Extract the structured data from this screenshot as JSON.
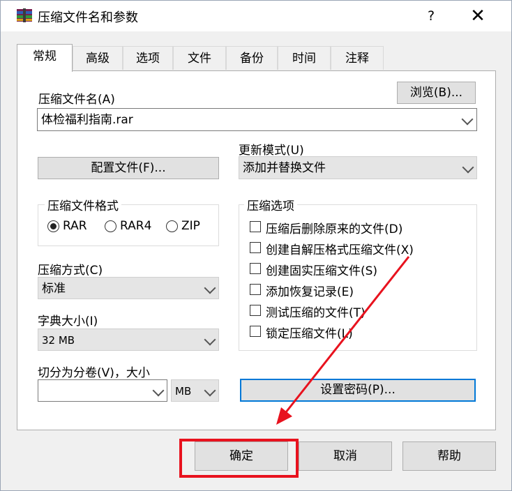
{
  "window": {
    "title": "压缩文件名和参数",
    "help": "?",
    "close": "✕"
  },
  "tabs": [
    {
      "label": "常规"
    },
    {
      "label": "高级"
    },
    {
      "label": "选项"
    },
    {
      "label": "文件"
    },
    {
      "label": "备份"
    },
    {
      "label": "时间"
    },
    {
      "label": "注释"
    }
  ],
  "general": {
    "archive_name_label": "压缩文件名(A)",
    "archive_name_value": "体检福利指南.rar",
    "browse_button": "浏览(B)...",
    "update_mode_label": "更新模式(U)",
    "update_mode_value": "添加并替换文件",
    "profiles_button": "配置文件(F)...",
    "format_group_title": "压缩文件格式",
    "formats": [
      {
        "label": "RAR",
        "selected": true
      },
      {
        "label": "RAR4",
        "selected": false
      },
      {
        "label": "ZIP",
        "selected": false
      }
    ],
    "method_label": "压缩方式(C)",
    "method_value": "标准",
    "dict_label": "字典大小(I)",
    "dict_value": "32 MB",
    "split_label": "切分为分卷(V)，大小",
    "split_value": "",
    "split_unit": "MB",
    "options_group_title": "压缩选项",
    "options": [
      {
        "label": "压缩后删除原来的文件(D)",
        "checked": false
      },
      {
        "label": "创建自解压格式压缩文件(X)",
        "checked": false
      },
      {
        "label": "创建固实压缩文件(S)",
        "checked": false
      },
      {
        "label": "添加恢复记录(E)",
        "checked": false
      },
      {
        "label": "测试压缩的文件(T)",
        "checked": false
      },
      {
        "label": "锁定压缩文件(L)",
        "checked": false
      }
    ],
    "password_button": "设置密码(P)..."
  },
  "footer": {
    "ok": "确定",
    "cancel": "取消",
    "help": "帮助"
  },
  "annotation_color": "#e8121e"
}
